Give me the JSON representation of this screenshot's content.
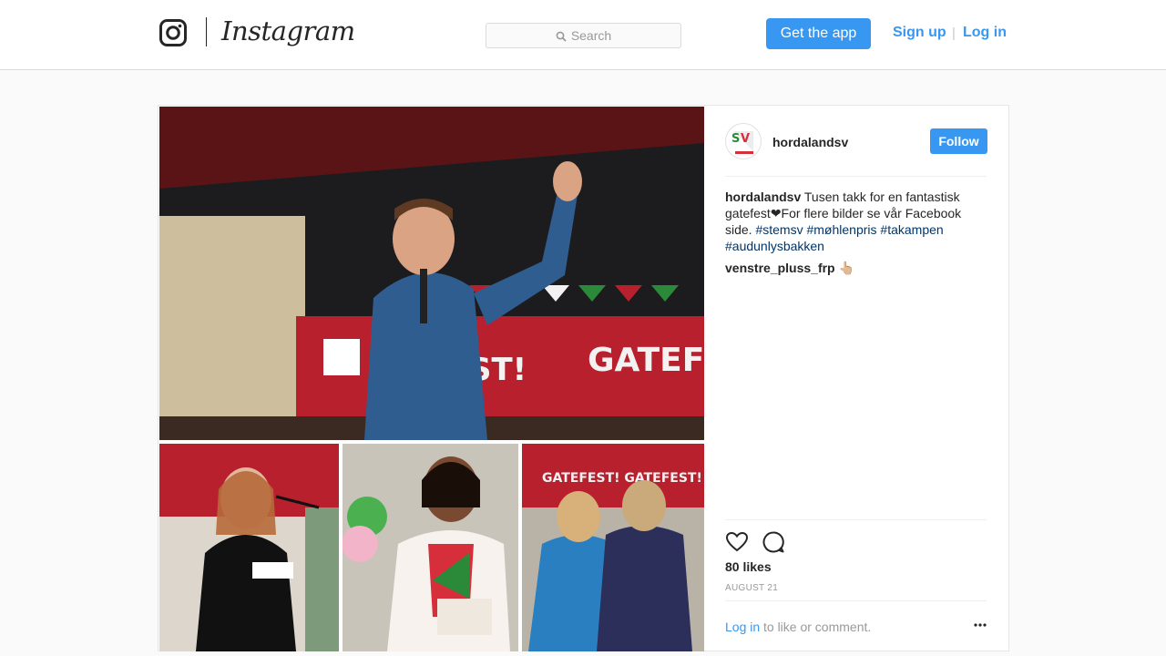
{
  "header": {
    "brand": "Instagram",
    "search_placeholder": "Search",
    "get_app_label": "Get the app",
    "signup_label": "Sign up",
    "separator": "|",
    "login_label": "Log in"
  },
  "post": {
    "author": "hordalandsv",
    "follow_label": "Follow",
    "caption": {
      "username": "hordalandsv",
      "text": "Tusen takk for en fantastisk gatefest❤For flere bilder se vår Facebook side.",
      "hashtags": [
        "#stemsv",
        "#møhlenpris",
        "#takampen",
        "#audunlysbakken"
      ]
    },
    "comments": [
      {
        "username": "venstre_pluss_frp",
        "text": "👆🏼"
      }
    ],
    "likes": "80 likes",
    "date": "AUGUST 21",
    "add_comment": {
      "login_label": "Log in",
      "text": "to like or comment."
    }
  },
  "colors": {
    "accent": "#3897f0",
    "hashtag": "#003569",
    "border": "#dbdbdb",
    "banner_red": "#b8202e",
    "banner_green": "#2b8a3a"
  },
  "icons": [
    "instagram-glyph-icon",
    "search-icon",
    "heart-icon",
    "comment-bubble-icon",
    "more-options-icon"
  ]
}
